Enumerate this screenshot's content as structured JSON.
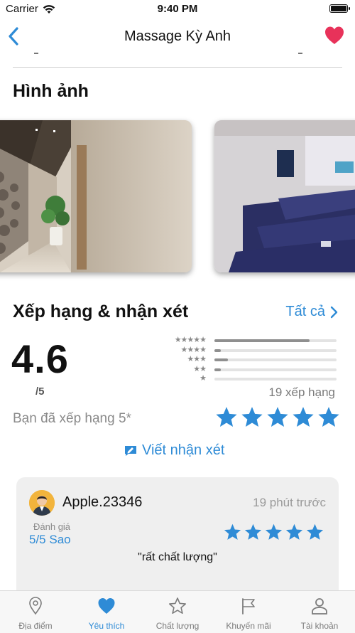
{
  "status_bar": {
    "carrier": "Carrier",
    "time": "9:40 PM"
  },
  "nav": {
    "title": "Massage Kỳ Anh",
    "back_icon": "chevron-left-icon",
    "favorite_icon": "heart-icon",
    "favorite_color": "#e8325a"
  },
  "images_section": {
    "title": "Hình ảnh"
  },
  "ratings": {
    "title": "Xếp hạng & nhận xét",
    "see_all": "Tất cả",
    "average": "4.6",
    "out_of": "/5",
    "count_text": "19 xếp hạng",
    "distribution": [
      {
        "stars": 5,
        "fraction": 0.78
      },
      {
        "stars": 4,
        "fraction": 0.05
      },
      {
        "stars": 3,
        "fraction": 0.11
      },
      {
        "stars": 2,
        "fraction": 0.05
      },
      {
        "stars": 1,
        "fraction": 0.0
      }
    ],
    "your_rating_text": "Bạn đã xếp hạng 5*",
    "your_rating_stars": 5,
    "write_review": "Viết nhận xét"
  },
  "review": {
    "user": "Apple.23346",
    "time": "19 phút trước",
    "label": "Đánh giá",
    "score": "5/5 Sao",
    "stars": 5,
    "text": "\"rất chất lượng\""
  },
  "tabs": [
    {
      "label": "Địa điểm",
      "icon": "location-pin-icon",
      "active": false
    },
    {
      "label": "Yêu thích",
      "icon": "heart-icon",
      "active": true
    },
    {
      "label": "Chất lượng",
      "icon": "star-icon",
      "active": false
    },
    {
      "label": "Khuyến mãi",
      "icon": "flag-icon",
      "active": false
    },
    {
      "label": "Tài khoản",
      "icon": "person-icon",
      "active": false
    }
  ],
  "colors": {
    "accent": "#2e8bd6",
    "star": "#2e8bd6",
    "heart": "#e8325a"
  }
}
